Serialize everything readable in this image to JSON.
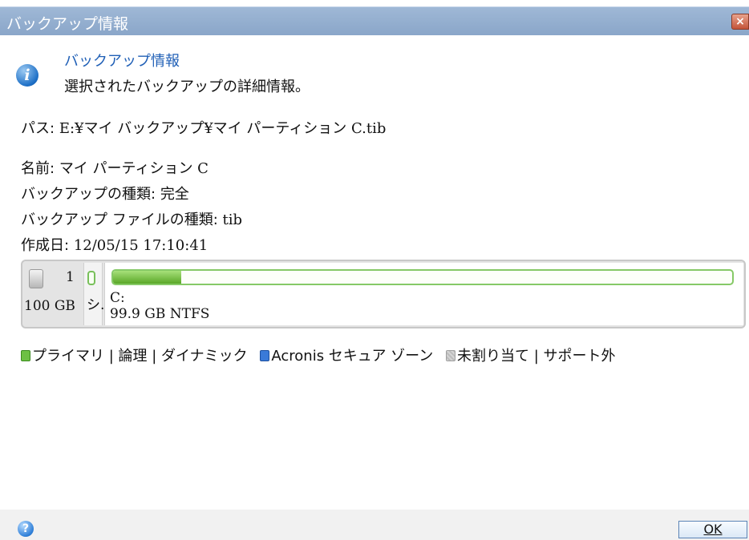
{
  "window": {
    "title": "バックアップ情報",
    "close_label": "×"
  },
  "header": {
    "title": "バックアップ情報",
    "subtitle": "選択されたバックアップの詳細情報。",
    "icon": "info-icon"
  },
  "details": {
    "path_label": "パス:",
    "path_value": "E:¥マイ バックアップ¥マイ パーティション C.tib",
    "name_label": "名前:",
    "name_value": "マイ パーティション C",
    "backup_type_label": "バックアップの種類:",
    "backup_type_value": "完全",
    "file_type_label": "バックアップ ファイルの種類:",
    "file_type_value": "tib",
    "created_label": "作成日:",
    "created_value": "12/05/15 17:10:41"
  },
  "disk": {
    "number": "1",
    "size": "100 GB",
    "system_label": "シ.",
    "partition_letter": "C:",
    "partition_detail": "99.9 GB  NTFS",
    "used_fraction": 0.11,
    "colors": {
      "primary": "#6dc043",
      "acronis": "#3a7ad8",
      "unallocated": "#c8c8c8"
    }
  },
  "legend": {
    "primary": "プライマリ | 論理 | ダイナミック",
    "acronis": "Acronis セキュア ゾーン",
    "unallocated": "未割り当て | サポート外"
  },
  "footer": {
    "help_icon": "help-icon",
    "help_label": "?",
    "ok_label": "OK"
  }
}
